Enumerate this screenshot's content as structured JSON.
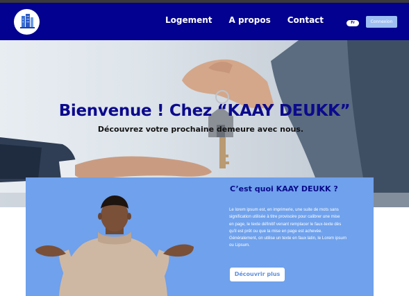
{
  "nav": {
    "links": [
      "Logement",
      "A propos",
      "Contact"
    ],
    "language": "Fr",
    "login_label": "Connexion"
  },
  "hero": {
    "title": "Bienvenue ! Chez “KAAY DEUKK”",
    "subtitle": "Découvrez votre prochaine demeure avec nous."
  },
  "about": {
    "title": "C’est quoi KAAY DEUKK ?",
    "body_lines": [
      "Le lorem ipsum est, en imprimerie, une suite de mots sans",
      "signification utilisée à titre provisoire pour calibrer une mise",
      "en  page, le texte définitif venant remplacer le faux-texte dès",
      "qu'il est  prêt ou que la mise en page est achevée.",
      "Généralement, on utilise un texte en faux latin, le Lorem ipsum",
      "ou  Lipsum."
    ],
    "button_label": "Découvrir plus"
  },
  "colors": {
    "navbar": "#03018f",
    "hero_title": "#0c0a8c",
    "about_bg": "#6fa1ec",
    "login_button": "#9ebff3",
    "about_title": "#0a0a8a"
  }
}
